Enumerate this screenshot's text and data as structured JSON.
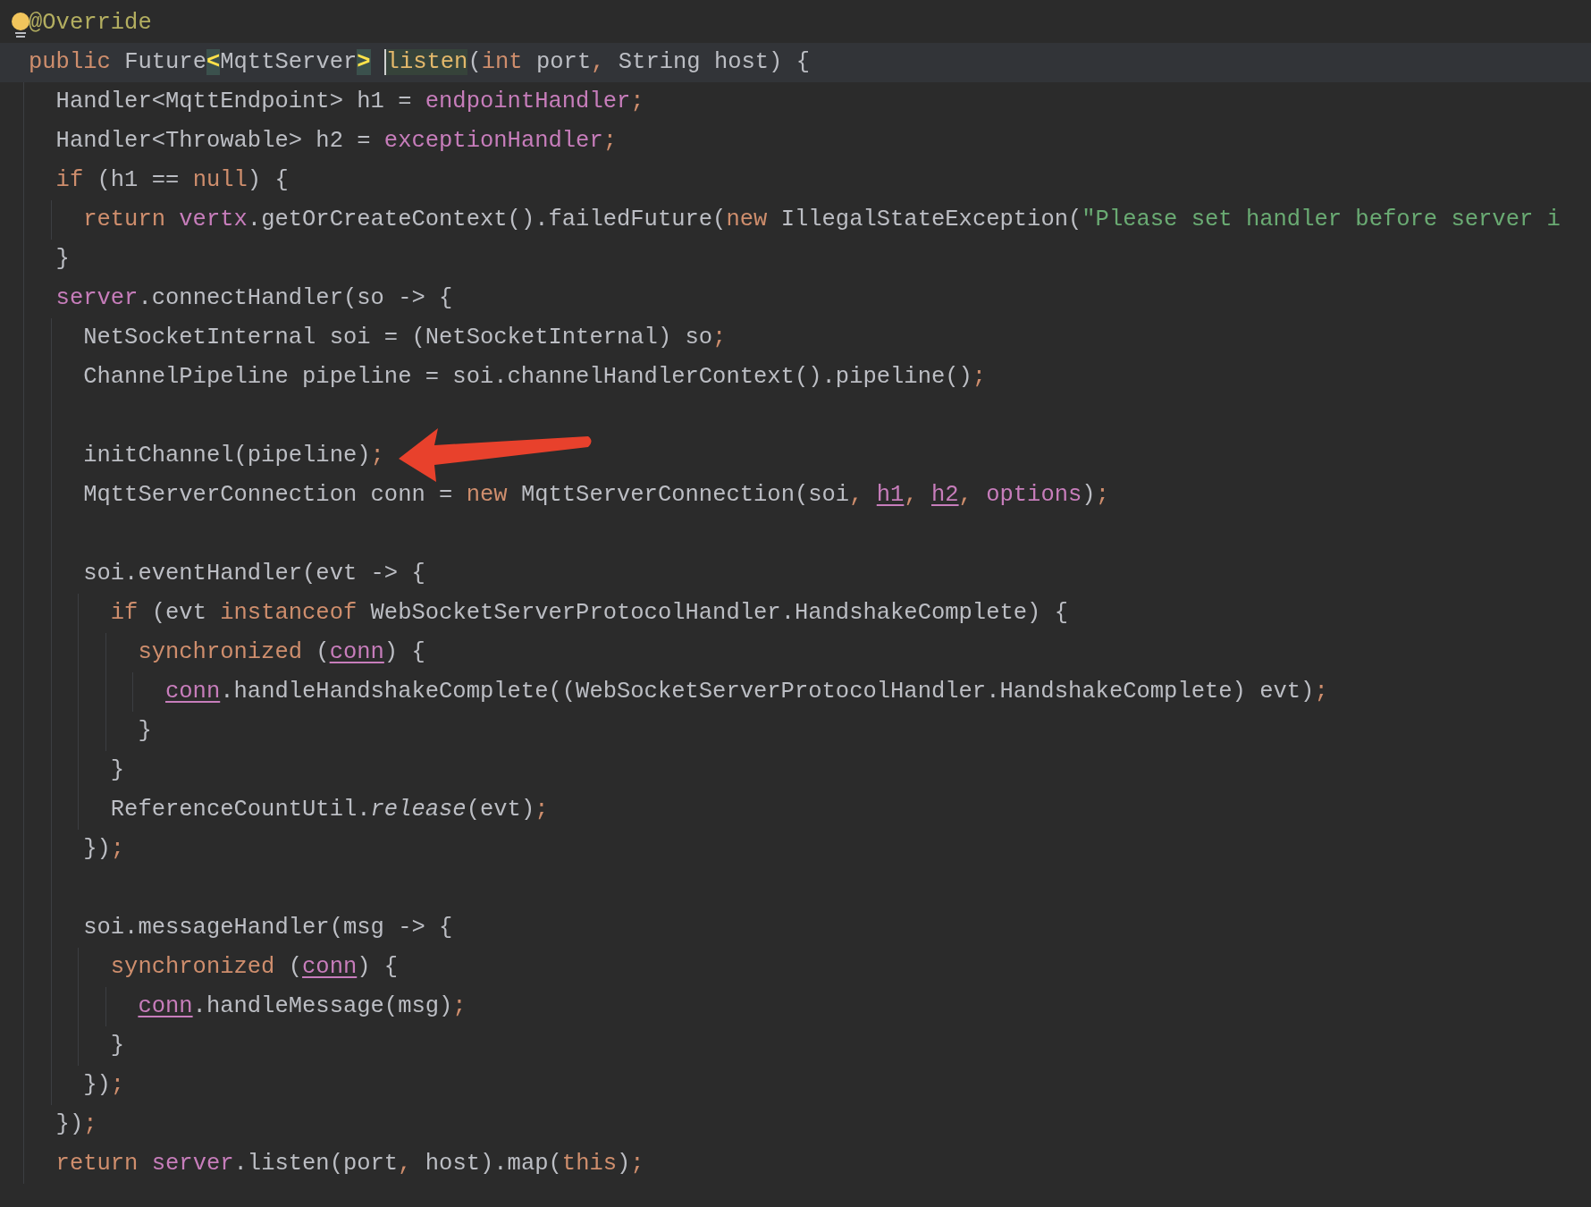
{
  "editor": {
    "lines": [
      {
        "kind": "code",
        "tokens": [
          {
            "text": "@Override",
            "kind": "annotation"
          }
        ]
      },
      {
        "kind": "code",
        "current": true,
        "tokens": [
          {
            "text": "public ",
            "kind": "keyword"
          },
          {
            "text": "Future",
            "kind": "plain"
          },
          {
            "text": "<",
            "kind": "brace-match"
          },
          {
            "text": "MqttServer",
            "kind": "plain"
          },
          {
            "text": ">",
            "kind": "brace-match"
          },
          {
            "text": "listen",
            "kind": "declaration",
            "caret": true
          },
          {
            "text": "(",
            "kind": "plain"
          },
          {
            "text": "int ",
            "kind": "keyword"
          },
          {
            "text": "port",
            "kind": "plain"
          },
          {
            "text": ", ",
            "kind": "punct"
          },
          {
            "text": "String host) {",
            "kind": "plain"
          }
        ],
        "children": [
          {
            "kind": "code",
            "tokens": [
              {
                "text": "Handler<MqttEndpoint> h1 = ",
                "kind": "plain"
              },
              {
                "text": "endpointHandler",
                "kind": "field"
              },
              {
                "text": ";",
                "kind": "punct"
              }
            ]
          },
          {
            "kind": "code",
            "tokens": [
              {
                "text": "Handler<Throwable> h2 = ",
                "kind": "plain"
              },
              {
                "text": "exceptionHandler",
                "kind": "field"
              },
              {
                "text": ";",
                "kind": "punct"
              }
            ]
          },
          {
            "kind": "code",
            "tokens": [
              {
                "text": "if ",
                "kind": "keyword"
              },
              {
                "text": "(h1 == ",
                "kind": "plain"
              },
              {
                "text": "null",
                "kind": "keyword"
              },
              {
                "text": ") {",
                "kind": "plain"
              }
            ],
            "children": [
              {
                "kind": "code",
                "tokens": [
                  {
                    "text": "return ",
                    "kind": "keyword"
                  },
                  {
                    "text": "vertx",
                    "kind": "field"
                  },
                  {
                    "text": ".getOrCreateContext().failedFuture(",
                    "kind": "plain"
                  },
                  {
                    "text": "new ",
                    "kind": "keyword"
                  },
                  {
                    "text": "IllegalStateException(",
                    "kind": "plain"
                  },
                  {
                    "text": "\"Please set handler before server i",
                    "kind": "string"
                  }
                ]
              }
            ]
          },
          {
            "kind": "code",
            "tokens": [
              {
                "text": "}",
                "kind": "plain"
              }
            ]
          },
          {
            "kind": "code",
            "tokens": [
              {
                "text": "server",
                "kind": "field"
              },
              {
                "text": ".connectHandler(so -> {",
                "kind": "plain"
              }
            ],
            "children": [
              {
                "kind": "code",
                "tokens": [
                  {
                    "text": "NetSocketInternal soi = (NetSocketInternal) so",
                    "kind": "plain"
                  },
                  {
                    "text": ";",
                    "kind": "punct"
                  }
                ]
              },
              {
                "kind": "code",
                "tokens": [
                  {
                    "text": "ChannelPipeline pipeline = soi.channelHandlerContext().pipeline()",
                    "kind": "plain"
                  },
                  {
                    "text": ";",
                    "kind": "punct"
                  }
                ]
              },
              {
                "kind": "blank"
              },
              {
                "kind": "code",
                "tokens": [
                  {
                    "text": "initChannel(pipeline)",
                    "kind": "plain"
                  },
                  {
                    "text": ";",
                    "kind": "punct"
                  }
                ]
              },
              {
                "kind": "code",
                "tokens": [
                  {
                    "text": "MqttServerConnection conn = ",
                    "kind": "plain"
                  },
                  {
                    "text": "new ",
                    "kind": "keyword"
                  },
                  {
                    "text": "MqttServerConnection(soi",
                    "kind": "plain"
                  },
                  {
                    "text": ", ",
                    "kind": "punct"
                  },
                  {
                    "text": "h1",
                    "kind": "captured"
                  },
                  {
                    "text": ", ",
                    "kind": "punct"
                  },
                  {
                    "text": "h2",
                    "kind": "captured"
                  },
                  {
                    "text": ", ",
                    "kind": "punct"
                  },
                  {
                    "text": "options",
                    "kind": "field"
                  },
                  {
                    "text": ")",
                    "kind": "plain"
                  },
                  {
                    "text": ";",
                    "kind": "punct"
                  }
                ]
              },
              {
                "kind": "blank"
              },
              {
                "kind": "code",
                "tokens": [
                  {
                    "text": "soi.eventHandler(evt -> {",
                    "kind": "plain"
                  }
                ],
                "children": [
                  {
                    "kind": "code",
                    "tokens": [
                      {
                        "text": "if ",
                        "kind": "keyword"
                      },
                      {
                        "text": "(evt ",
                        "kind": "plain"
                      },
                      {
                        "text": "instanceof ",
                        "kind": "keyword"
                      },
                      {
                        "text": "WebSocketServerProtocolHandler.HandshakeComplete) {",
                        "kind": "plain"
                      }
                    ],
                    "children": [
                      {
                        "kind": "code",
                        "tokens": [
                          {
                            "text": "synchronized ",
                            "kind": "keyword"
                          },
                          {
                            "text": "(",
                            "kind": "plain"
                          },
                          {
                            "text": "conn",
                            "kind": "captured"
                          },
                          {
                            "text": ") {",
                            "kind": "plain"
                          }
                        ],
                        "children": [
                          {
                            "kind": "code",
                            "tokens": [
                              {
                                "text": "conn",
                                "kind": "captured"
                              },
                              {
                                "text": ".handleHandshakeComplete((WebSocketServerProtocolHandler.HandshakeComplete) evt)",
                                "kind": "plain"
                              },
                              {
                                "text": ";",
                                "kind": "punct"
                              }
                            ]
                          }
                        ]
                      },
                      {
                        "kind": "code",
                        "tokens": [
                          {
                            "text": "}",
                            "kind": "plain"
                          }
                        ]
                      }
                    ]
                  },
                  {
                    "kind": "code",
                    "tokens": [
                      {
                        "text": "}",
                        "kind": "plain"
                      }
                    ]
                  },
                  {
                    "kind": "code",
                    "tokens": [
                      {
                        "text": "ReferenceCountUtil.",
                        "kind": "plain"
                      },
                      {
                        "text": "release",
                        "kind": "static-call"
                      },
                      {
                        "text": "(evt)",
                        "kind": "plain"
                      },
                      {
                        "text": ";",
                        "kind": "punct"
                      }
                    ]
                  }
                ]
              },
              {
                "kind": "code",
                "tokens": [
                  {
                    "text": "})",
                    "kind": "plain"
                  },
                  {
                    "text": ";",
                    "kind": "punct"
                  }
                ]
              },
              {
                "kind": "blank"
              },
              {
                "kind": "code",
                "tokens": [
                  {
                    "text": "soi.messageHandler(msg -> {",
                    "kind": "plain"
                  }
                ],
                "children": [
                  {
                    "kind": "code",
                    "tokens": [
                      {
                        "text": "synchronized ",
                        "kind": "keyword"
                      },
                      {
                        "text": "(",
                        "kind": "plain"
                      },
                      {
                        "text": "conn",
                        "kind": "captured"
                      },
                      {
                        "text": ") {",
                        "kind": "plain"
                      }
                    ],
                    "children": [
                      {
                        "kind": "code",
                        "tokens": [
                          {
                            "text": "conn",
                            "kind": "captured"
                          },
                          {
                            "text": ".handleMessage(msg)",
                            "kind": "plain"
                          },
                          {
                            "text": ";",
                            "kind": "punct"
                          }
                        ]
                      }
                    ]
                  },
                  {
                    "kind": "code",
                    "tokens": [
                      {
                        "text": "}",
                        "kind": "plain"
                      }
                    ]
                  }
                ]
              },
              {
                "kind": "code",
                "tokens": [
                  {
                    "text": "})",
                    "kind": "plain"
                  },
                  {
                    "text": ";",
                    "kind": "punct"
                  }
                ]
              }
            ]
          },
          {
            "kind": "code",
            "tokens": [
              {
                "text": "})",
                "kind": "plain"
              },
              {
                "text": ";",
                "kind": "punct"
              }
            ]
          },
          {
            "kind": "code",
            "tokens": [
              {
                "text": "return ",
                "kind": "keyword"
              },
              {
                "text": "server",
                "kind": "field"
              },
              {
                "text": ".listen(port",
                "kind": "plain"
              },
              {
                "text": ", ",
                "kind": "punct"
              },
              {
                "text": "host).map(",
                "kind": "plain"
              },
              {
                "text": "this",
                "kind": "keyword"
              },
              {
                "text": ")",
                "kind": "plain"
              },
              {
                "text": ";",
                "kind": "punct"
              }
            ]
          }
        ]
      }
    ]
  }
}
